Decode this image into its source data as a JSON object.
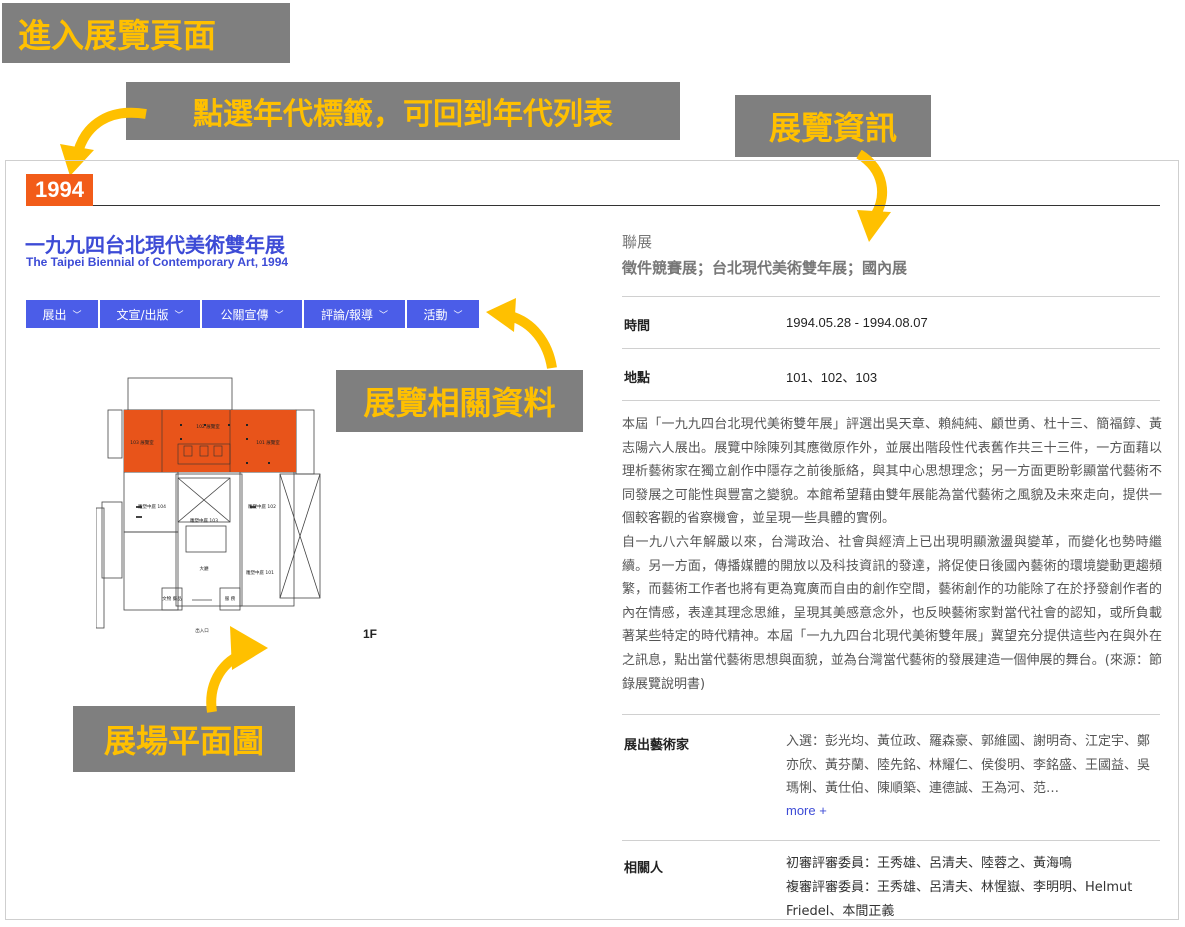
{
  "annotations": {
    "enter": "進入展覽頁面",
    "year_tag_hint": "點選年代標籤，可回到年代列表",
    "exhibition_info": "展覽資訊",
    "related_materials": "展覽相關資料",
    "floor_plan": "展場平面圖"
  },
  "exhibition": {
    "year": "1994",
    "title_zh": "一九九四台北現代美術雙年展",
    "title_en": "The Taipei Biennial of Contemporary Art, 1994"
  },
  "nav": {
    "items": [
      {
        "label": "展出"
      },
      {
        "label": "文宣/出版"
      },
      {
        "label": "公關宣傳"
      },
      {
        "label": "評論/報導"
      },
      {
        "label": "活動"
      }
    ],
    "chevron": "chevron-down-icon"
  },
  "floor_plan": {
    "floor": "1F",
    "rooms": {
      "r102": "102 展覽室",
      "r103": "103 展覽室",
      "r101": "101 展覽室",
      "r104": "雕塑中庭 104",
      "r102b": "雕塑中庭 102",
      "r103b": "雕塑中庭 103",
      "r101b": "雕塑中庭 101",
      "hall": "大廳",
      "shop": "文物 藝品",
      "service": "服 務",
      "entrance": "出入口"
    },
    "highlight_color": "#e8541a"
  },
  "info": {
    "category1": "聯展",
    "category2": "徵件競賽展；台北現代美術雙年展；國內展",
    "time_label": "時間",
    "time_value": "1994.05.28 - 1994.08.07",
    "place_label": "地點",
    "place_value": "101、102、103",
    "desc_p1": "本屆「一九九四台北現代美術雙年展」評選出吳天章、賴純純、顧世勇、杜十三、簡福錞、黃志陽六人展出。展覽中除陳列其應徵原作外，並展出階段性代表舊作共三十三件，一方面藉以理析藝術家在獨立創作中隱存之前後脈絡，與其中心思想理念；另一方面更盼彰顯當代藝術不同發展之可能性與豐富之變貌。本館希望藉由雙年展能為當代藝術之風貌及未來走向，提供一個較客觀的省察機會，並呈現一些具體的實例。",
    "desc_p2": "自一九八六年解嚴以來，台灣政治、社會與經濟上已出現明顯激盪與變革，而變化也勢時繼續。另一方面，傳播媒體的開放以及科技資訊的發達，將促使日後國內藝術的環境變動更趨頻繁，而藝術工作者也將有更為寬廣而自由的創作空間，藝術創作的功能除了在於抒發創作者的內在情感，表達其理念思維，呈現其美感意念外，也反映藝術家對當代社會的認知，或所負載著某些特定的時代精神。本屆「一九九四台北現代美術雙年展」冀望充分提供這些內在與外在之訊息，點出當代藝術思想與面貌，並為台灣當代藝術的發展建造一個伸展的舞台。(來源：節錄展覽說明書)",
    "artists_label": "展出藝術家",
    "artists_value": "入選：彭光均、黃位政、羅森豪、郭維國、謝明奇、江定宇、鄭亦欣、黃芬蘭、陸先銘、林耀仁、侯俊明、李銘盛、王國益、吳瑪悧、黃仕伯、陳順築、連德誠、王為河、范…",
    "more": "more +",
    "people_label": "相關人",
    "people_line1": "初審評審委員：王秀雄、呂清夫、陸蓉之、黃海鳴",
    "people_line2": "複審評審委員：王秀雄、呂清夫、林惺嶽、李明明、Helmut Friedel、本間正義"
  },
  "colors": {
    "accent": "#f25c19",
    "nav": "#4b5de8",
    "title": "#3d4bd6",
    "annotation_bg": "#7f7f7f",
    "annotation_text": "#ffc000"
  }
}
